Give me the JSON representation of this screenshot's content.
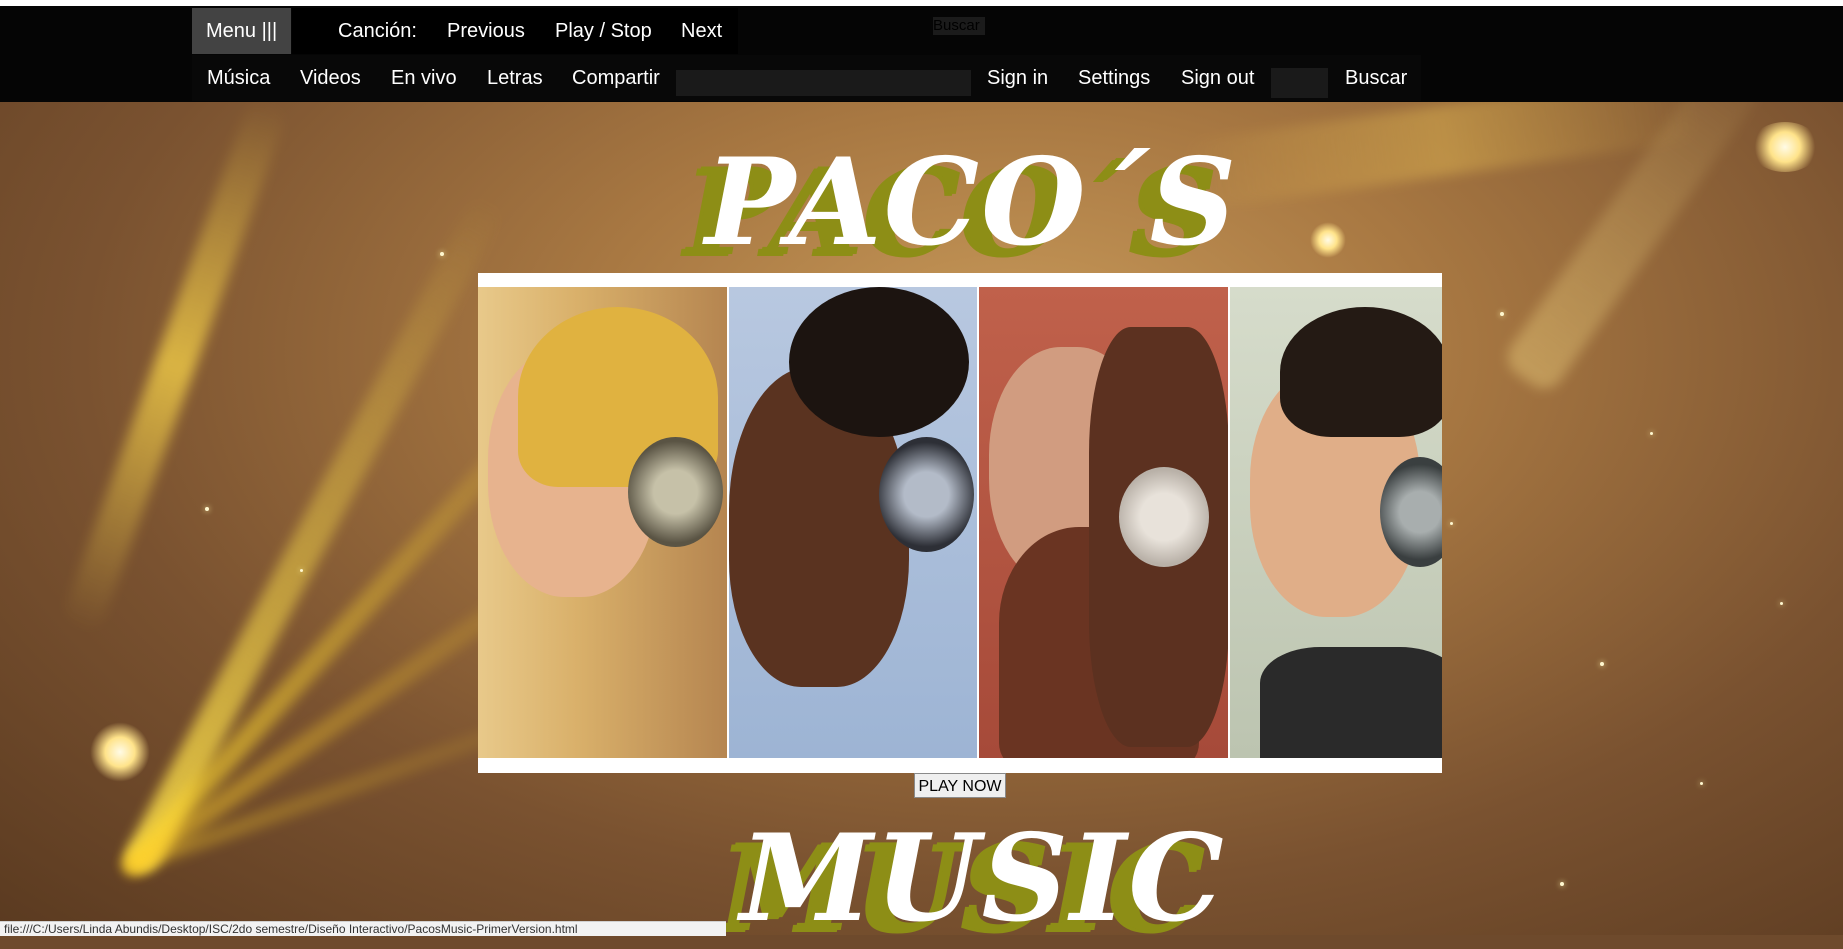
{
  "nav": {
    "menu_label": "Menu |||",
    "song_label": "Canción:",
    "previous_label": "Previous",
    "playstop_label": "Play / Stop",
    "next_label": "Next",
    "tiny_search": "Buscar",
    "links": [
      "Música",
      "Videos",
      "En vivo",
      "Letras",
      "Compartir"
    ],
    "signin_label": "Sign in",
    "settings_label": "Settings",
    "signout_label": "Sign out",
    "search_label": "Buscar"
  },
  "hero": {
    "title_top": "PACO´S",
    "title_bottom": "MUSIC",
    "play_button": "PLAY NOW"
  },
  "status": {
    "url": "file:///C:/Users/Linda Abundis/Desktop/ISC/2do semestre/Diseño Interactivo/PacosMusic-PrimerVersion.html"
  },
  "colors": {
    "navbar": "#050505",
    "title_shadow": "#8d8e16",
    "menu_button": "#434343"
  }
}
